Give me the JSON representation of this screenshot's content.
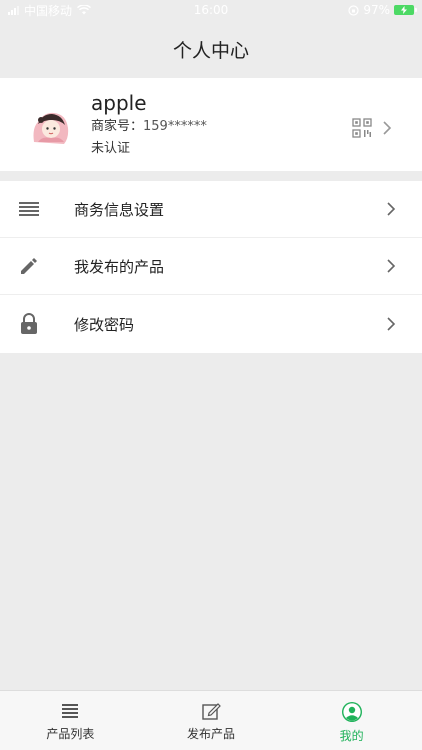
{
  "status_bar": {
    "carrier": "中国移动",
    "time": "16:00",
    "battery": "97%"
  },
  "nav": {
    "title": "个人中心"
  },
  "profile": {
    "name": "apple",
    "merchant_label": "商家号：",
    "merchant_value": "159******",
    "verify_status": "未认证"
  },
  "menu": {
    "items": [
      {
        "label": "商务信息设置",
        "icon": "list-icon"
      },
      {
        "label": "我发布的产品",
        "icon": "pencil-icon"
      },
      {
        "label": "修改密码",
        "icon": "lock-icon"
      }
    ]
  },
  "tabs": {
    "items": [
      {
        "label": "产品列表",
        "icon": "list-icon"
      },
      {
        "label": "发布产品",
        "icon": "edit-icon"
      },
      {
        "label": "我的",
        "icon": "user-icon",
        "active": true
      }
    ]
  },
  "colors": {
    "accent": "#1fb25a",
    "background": "#ececec",
    "battery": "#4cd964"
  }
}
